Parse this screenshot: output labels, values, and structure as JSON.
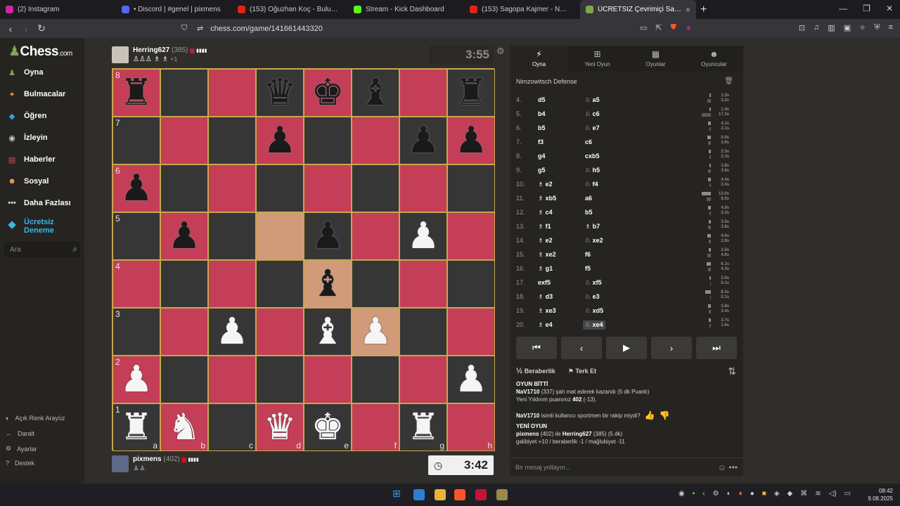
{
  "browser": {
    "tabs": [
      {
        "label": "(2) Instagram",
        "color": "#d6249f"
      },
      {
        "label": "• Discord | #genel | pixmens",
        "color": "#5865f2"
      },
      {
        "label": "(153) Oğuzhan Koç - Bulutlara Esir Ol",
        "color": "#e62117"
      },
      {
        "label": "Stream - Kick Dashboard",
        "color": "#53fc18"
      },
      {
        "label": "(153) Sagopa Kajmer - Neyse - Ya",
        "color": "#e62117"
      },
      {
        "label": "ÜCRETSİZ Çevrimiçi Satranç (",
        "color": "#7fa650",
        "active": true
      }
    ],
    "url": "chess.com/game/141661443320"
  },
  "sidebar": {
    "logo": "Chess",
    "logo_suffix": ".com",
    "items": [
      {
        "label": "Oyna",
        "icon": "play-icon",
        "glyph": "♟",
        "color": "#7fa650"
      },
      {
        "label": "Bulmacalar",
        "icon": "puzzle-icon",
        "glyph": "✦",
        "color": "#f18b3d"
      },
      {
        "label": "Öğren",
        "icon": "learn-icon",
        "glyph": "◆",
        "color": "#3aa3d6"
      },
      {
        "label": "İzleyin",
        "icon": "watch-icon",
        "glyph": "◉",
        "color": "#cfcfcf"
      },
      {
        "label": "Haberler",
        "icon": "news-icon",
        "glyph": "▤",
        "color": "#d85151"
      },
      {
        "label": "Sosyal",
        "icon": "social-icon",
        "glyph": "☻",
        "color": "#e8a85a"
      },
      {
        "label": "Daha Fazlası",
        "icon": "more-icon",
        "glyph": "•••",
        "color": "#cfcfcf"
      }
    ],
    "trial_label_1": "Ücretsiz",
    "trial_label_2": "Deneme",
    "search_placeholder": "Ara",
    "bottom": [
      "Açık Renk Arayüz",
      "Daralt",
      "Ayarlar",
      "Destek"
    ]
  },
  "top_player": {
    "name": "Herring627",
    "rating": "(385)",
    "captured_extra": "+1"
  },
  "bottom_player": {
    "name": "pixmens",
    "rating": "(402)"
  },
  "clocks": {
    "top": "3:55",
    "bottom": "3:42"
  },
  "board": {
    "ranks": [
      "8",
      "7",
      "6",
      "5",
      "4",
      "3",
      "2",
      "1"
    ],
    "files": [
      "a",
      "b",
      "c",
      "d",
      "e",
      "f",
      "g",
      "h"
    ],
    "position": [
      [
        "bR",
        "",
        "",
        "bQ",
        "bK",
        "bB",
        "",
        "bR"
      ],
      [
        "",
        "",
        "",
        "bP",
        "",
        "",
        "bP",
        "bP"
      ],
      [
        "bP",
        "",
        "",
        "",
        "",
        "",
        "",
        ""
      ],
      [
        "",
        "bP",
        "",
        "",
        "bP",
        "",
        "wP",
        ""
      ],
      [
        "",
        "",
        "",
        "",
        "bB",
        "",
        "",
        ""
      ],
      [
        "",
        "",
        "wP",
        "",
        "wB",
        "wP",
        "",
        ""
      ],
      [
        "wP",
        "",
        "",
        "",
        "",
        "",
        "",
        "wP"
      ],
      [
        "wR",
        "wN",
        "",
        "wQ",
        "wK",
        "",
        "wR",
        ""
      ]
    ],
    "highlights": [
      "d5",
      "e4",
      "f3"
    ]
  },
  "panel": {
    "tabs": [
      {
        "label": "Oyna",
        "glyph": "⚡"
      },
      {
        "label": "Yeni Oyun",
        "glyph": "⊞"
      },
      {
        "label": "Oyunlar",
        "glyph": "▦"
      },
      {
        "label": "Oyuncular",
        "glyph": "☻"
      }
    ],
    "opening": "Nimzowitsch Defense",
    "moves": [
      {
        "n": "4.",
        "w": "d5",
        "b": "♘ a5",
        "tw": "1.3s",
        "tb": "3.2s",
        "ww": 2,
        "wb": 5
      },
      {
        "n": "5.",
        "w": "b4",
        "b": "♘ c6",
        "tw": "1.4s",
        "tb": "17.3s",
        "ww": 2,
        "wb": 18
      },
      {
        "n": "6.",
        "w": "b5",
        "b": "♘ e7",
        "tw": "4.1s",
        "tb": "2.1s",
        "ww": 4,
        "wb": 2
      },
      {
        "n": "7.",
        "w": "f3",
        "b": "c6",
        "tw": "5.0s",
        "tb": "3.6s",
        "ww": 5,
        "wb": 4
      },
      {
        "n": "8.",
        "w": "g4",
        "b": "cxb5",
        "tw": "2.5s",
        "tb": "2.3s",
        "ww": 3,
        "wb": 2
      },
      {
        "n": "9.",
        "w": "g5",
        "b": "♘ h5",
        "tw": "1.8s",
        "tb": "3.6s",
        "ww": 2,
        "wb": 4
      },
      {
        "n": "10.",
        "w": "♗ e2",
        "b": "♘ f4",
        "tw": "4.4s",
        "tb": "2.4s",
        "ww": 4,
        "wb": 2
      },
      {
        "n": "11.",
        "w": "♗ xb5",
        "b": "a6",
        "tw": "13.0s",
        "tb": "6.5s",
        "ww": 13,
        "wb": 6
      },
      {
        "n": "12.",
        "w": "♗ c4",
        "b": "b5",
        "tw": "4.0s",
        "tb": "2.2s",
        "ww": 4,
        "wb": 2
      },
      {
        "n": "13.",
        "w": "♗ f1",
        "b": "♗ b7",
        "tw": "3.0s",
        "tb": "3.8s",
        "ww": 3,
        "wb": 4
      },
      {
        "n": "14.",
        "w": "♗ e2",
        "b": "♘ xe2",
        "tw": "4.6s",
        "tb": "2.8s",
        "ww": 5,
        "wb": 3
      },
      {
        "n": "15.",
        "w": "♗ xe2",
        "b": "f6",
        "tw": "2.5s",
        "tb": "4.6s",
        "ww": 3,
        "wb": 5
      },
      {
        "n": "16.",
        "w": "♗ g1",
        "b": "f5",
        "tw": "6.1s",
        "tb": "4.3s",
        "ww": 6,
        "wb": 4
      },
      {
        "n": "17.",
        "w": "exf5",
        "b": "♘ xf5",
        "tw": "2.0s",
        "tb": "0.1s",
        "ww": 2,
        "wb": 1
      },
      {
        "n": "18.",
        "w": "♗ d3",
        "b": "♘ e3",
        "tw": "8.3s",
        "tb": "0.1s",
        "ww": 8,
        "wb": 1
      },
      {
        "n": "19.",
        "w": "♗ xe3",
        "b": "♘ xd5",
        "tw": "3.8s",
        "tb": "3.4s",
        "ww": 4,
        "wb": 3
      },
      {
        "n": "20.",
        "w": "♗ e4",
        "b": "♘ xe4",
        "tw": "2.7s",
        "tb": "1.6s",
        "ww": 3,
        "wb": 2,
        "cur": true
      }
    ],
    "controls": [
      "⏮",
      "‹",
      "▶",
      "›",
      "⏭"
    ],
    "draw_label": "Beraberlik",
    "resign_label": "Terk Et",
    "chat": {
      "game_over": "OYUN BİTTİ",
      "result_name": "NaV1710",
      "result_text": " (337) şah mat ederek kazandı (5 dk Puanlı)",
      "rating_text": "Yeni Yıldırım puanınız ",
      "rating_new": "402",
      "rating_change": " (-13).",
      "sport_name": "NaV1710",
      "sport_text": " isimli kullanıcı sportmen bir rakip miydi?",
      "new_game": "YENİ OYUN",
      "ng_a": "pixmens",
      "ng_b": " (402) ile ",
      "ng_c": "Herring627",
      "ng_d": " (385) (5 dk)",
      "stakes": "galibiyet +10 / beraberlik -1 / mağlubiyet -11",
      "input_placeholder": "Bir mesaj yollayın..."
    }
  },
  "taskbar": {
    "time": "08:42",
    "date": "9.08.2025"
  }
}
